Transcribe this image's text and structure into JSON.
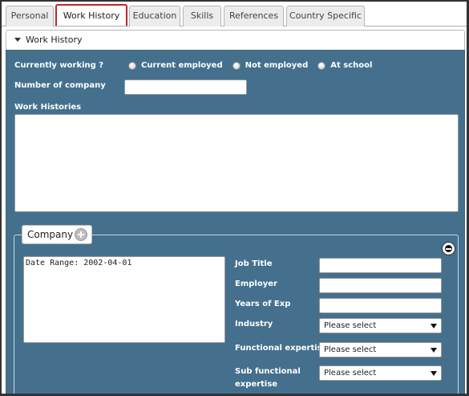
{
  "tabs": [
    {
      "label": "Personal",
      "active": false
    },
    {
      "label": "Work History",
      "active": true
    },
    {
      "label": "Education",
      "active": false
    },
    {
      "label": "Skills",
      "active": false
    },
    {
      "label": "References",
      "active": false
    },
    {
      "label": "Country Specific",
      "active": false
    }
  ],
  "section": {
    "title": "Work History",
    "icon": "caret-down-icon"
  },
  "form": {
    "currently_working_label": "Currently working ?",
    "radio_options": [
      "Current employed",
      "Not employed",
      "At school"
    ],
    "number_of_company_label": "Number of company",
    "number_of_company_value": "",
    "work_histories_label": "Work Histories",
    "work_histories_value": ""
  },
  "company": {
    "legend": "Company",
    "add_icon": "plus-icon",
    "remove_icon": "minus-icon",
    "summary_text": "Date Range: 2002-04-01",
    "fields": {
      "job_title_label": "Job Title",
      "employer_label": "Employer",
      "years_of_exp_label": "Years of Exp",
      "industry_label": "Industry",
      "functional_expertise_label": "Functional expertise",
      "sub_functional_expertise_label_1": "Sub functional",
      "sub_functional_expertise_label_2": "expertise",
      "job_title_value": "",
      "employer_value": "",
      "years_of_exp_value": "",
      "industry_value": "Please select",
      "functional_expertise_value": "Please select",
      "sub_functional_expertise_value": "Please select"
    }
  },
  "colors": {
    "panel": "#44708e",
    "active_tab_border": "#c0262d"
  }
}
